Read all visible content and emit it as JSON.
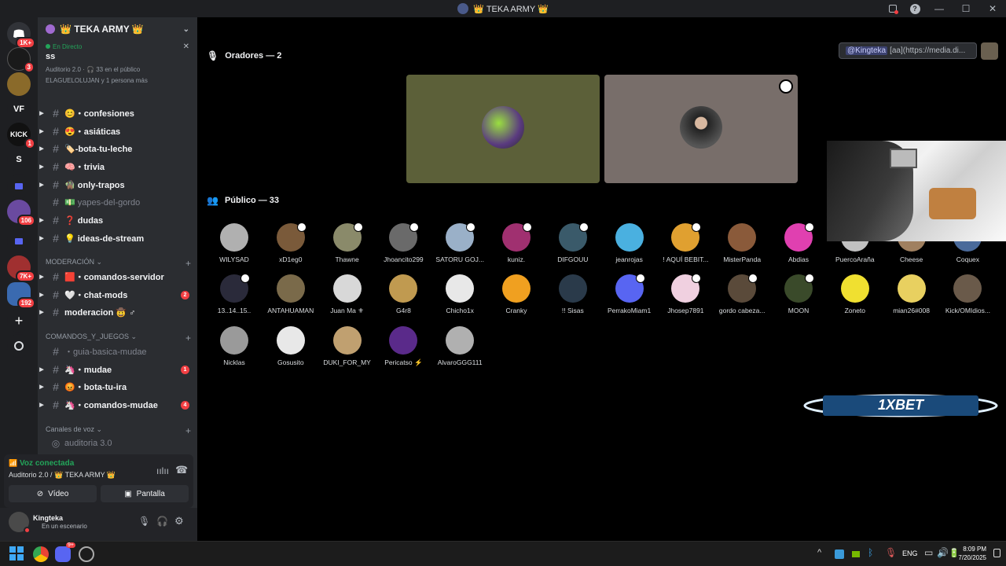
{
  "window": {
    "title": "👑 TEKA ARMY 👑"
  },
  "servers": [
    {
      "badge": "1K+"
    },
    {
      "badge": "3"
    },
    {
      "badge": ""
    },
    {
      "label": "VF"
    },
    {
      "label": "KICK",
      "badge": "1"
    },
    {
      "label": "S"
    },
    {
      "badge": ""
    },
    {
      "badge": "106"
    },
    {
      "badge": ""
    },
    {
      "badge": "7K+"
    },
    {
      "badge": "192"
    }
  ],
  "guild": {
    "name": "👑 TEKA ARMY 👑"
  },
  "live": {
    "status": "En Directo",
    "stage_name": "ss",
    "meta": "Auditorio 2.0 · 🎧 33 en el público",
    "people": "ELAGUELOLUJAN y 1 persona más"
  },
  "channels": [
    {
      "name": "😊・confesiones",
      "bold": true
    },
    {
      "name": "😍・asiáticas",
      "bold": true
    },
    {
      "name": "🏷️-bota-tu-leche",
      "bold": true
    },
    {
      "name": "🧠・trivia",
      "bold": true
    },
    {
      "name": "🧌 only-trapos",
      "bold": true
    },
    {
      "name": "💵 yapes-del-gordo",
      "bold": false
    },
    {
      "name": "❓ dudas",
      "bold": true
    },
    {
      "name": "💡 ideas-de-stream",
      "bold": true
    }
  ],
  "categories": {
    "moderacion": "MODERACIÓN",
    "comandos": "COMANDOS_Y_JUEGOS",
    "voz": "Canales de voz"
  },
  "mod_channels": [
    {
      "name": "🟥・comandos-servidor",
      "badge": ""
    },
    {
      "name": "🤍・chat-mods",
      "badge": "2"
    },
    {
      "name": "moderacion 🤠 ♂",
      "badge": ""
    }
  ],
  "game_channels": [
    {
      "name": "・guia-basica-mudae",
      "badge": "",
      "muted": true
    },
    {
      "name": "🦄・mudae",
      "badge": "1"
    },
    {
      "name": "😡・bota-tu-ira",
      "badge": ""
    },
    {
      "name": "🦄・comandos-mudae",
      "badge": "4"
    }
  ],
  "voice_channel": "auditoria 3.0",
  "voice": {
    "status": "Voz conectada",
    "location": "Auditorio 2.0 / 👑 TEKA ARMY 👑",
    "video_label": "Vídeo",
    "screen_label": "Pantalla"
  },
  "user": {
    "name": "Kingteka",
    "status": "En un escenario"
  },
  "stage": {
    "speakers_title": "Oradores — 2",
    "audience_title": "Público — 33",
    "chip_mention": "@Kingteka",
    "chip_text": "[aa](https://media.di..."
  },
  "audience": [
    {
      "name": "WILYSAD",
      "color": "#b0b0b0",
      "mod": false
    },
    {
      "name": "xD1eg0",
      "color": "#7a5a3a",
      "mod": true
    },
    {
      "name": "Thawne",
      "color": "#8a8a6a",
      "mod": true
    },
    {
      "name": "Jhoancito299",
      "color": "#6a6a6a",
      "mod": true
    },
    {
      "name": "SATORU GOJ...",
      "color": "#9ab0c8",
      "mod": true
    },
    {
      "name": "kuniz.",
      "color": "#a03070",
      "mod": true
    },
    {
      "name": "DIFGOUU",
      "color": "#3a5a6a",
      "mod": true
    },
    {
      "name": "jeanrojas",
      "color": "#4ab0e0",
      "mod": false
    },
    {
      "name": "! AQUÍ BEBIT...",
      "color": "#e0a030",
      "mod": true
    },
    {
      "name": "MisterPanda",
      "color": "#8a5a3a",
      "mod": false
    },
    {
      "name": "Abdias",
      "color": "#e040b0",
      "mod": true
    },
    {
      "name": "PuercoAraña",
      "color": "#c0c0c0",
      "mod": false
    },
    {
      "name": "Cheese",
      "color": "#a08060",
      "mod": false
    },
    {
      "name": "Coquex",
      "color": "#4a6a9a",
      "mod": false
    },
    {
      "name": "13..14..15..",
      "color": "#2a2a3a",
      "mod": true
    },
    {
      "name": "ANTAHUAMAN",
      "color": "#7a6a4a",
      "mod": false
    },
    {
      "name": "Juan Ma ⚜",
      "color": "#d8d8d8",
      "mod": false
    },
    {
      "name": "G4r8",
      "color": "#c09a50",
      "mod": false
    },
    {
      "name": "Chicho1x",
      "color": "#e8e8e8",
      "mod": false
    },
    {
      "name": "Cranky",
      "color": "#f0a020",
      "mod": false
    },
    {
      "name": "!! Sisas",
      "color": "#2a3a4a",
      "mod": false
    },
    {
      "name": "PerrakoMiam1",
      "color": "#5865f2",
      "mod": true
    },
    {
      "name": "Jhosep7891",
      "color": "#f0d0e0",
      "mod": true
    },
    {
      "name": "gordo cabeza...",
      "color": "#5a4a3a",
      "mod": true
    },
    {
      "name": "MOON",
      "color": "#3a4a2a",
      "mod": true
    },
    {
      "name": "Zoneto",
      "color": "#f0e030",
      "mod": false
    },
    {
      "name": "mian26#008",
      "color": "#e8d060",
      "mod": false
    },
    {
      "name": "Kick/OMIdios...",
      "color": "#6a5a4a",
      "mod": false
    },
    {
      "name": "Nicklas",
      "color": "#9a9a9a",
      "mod": false
    },
    {
      "name": "Gosusito",
      "color": "#e8e8e8",
      "mod": false
    },
    {
      "name": "DUKI_FOR_MY",
      "color": "#c0a070",
      "mod": false
    },
    {
      "name": "Pericatso ⚡",
      "color": "#5a2a8a",
      "mod": false
    },
    {
      "name": "AlvaroGGG111",
      "color": "#b0b0b0",
      "mod": false
    }
  ],
  "promo": {
    "text": "1XBET"
  },
  "taskbar": {
    "lang": "ENG",
    "time": "8:09 PM",
    "date": "7/20/2025",
    "discord_badge": "9+"
  },
  "colors": {
    "accent": "#5865f2",
    "green": "#23a55a",
    "red": "#f23f43"
  }
}
